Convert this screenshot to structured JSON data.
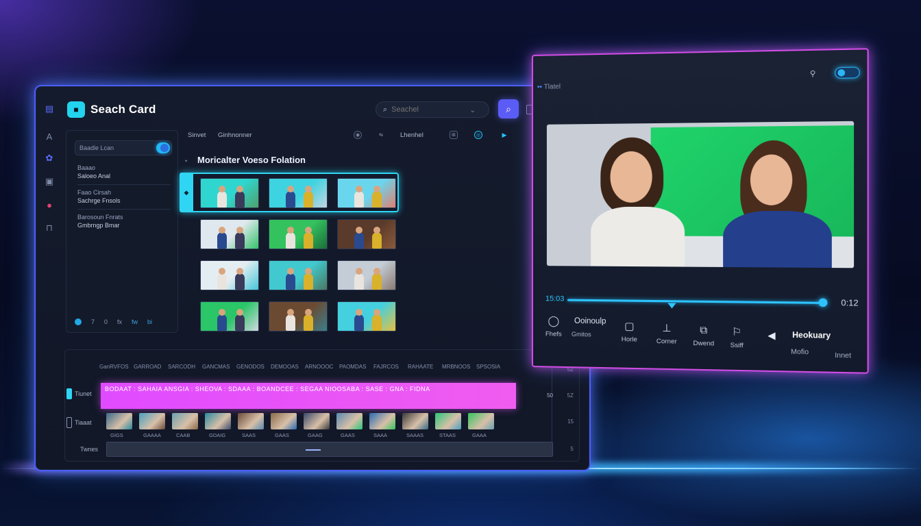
{
  "app": {
    "title": "Seaсh Card",
    "search_placeholder": "Seachel"
  },
  "sidebar_filter": {
    "search_value": "Baadle Lcan",
    "groups": [
      {
        "label": "Baaao",
        "value": "Saloeo Anal"
      },
      {
        "label": "Faao Cirsah",
        "value": "Sachrge Fnsols"
      },
      {
        "label": "Barosoun Fnrats",
        "value": "Gmbrngp Bmar"
      }
    ],
    "footer": [
      "7",
      "0",
      "fx",
      "fw",
      "bi"
    ]
  },
  "results_tabs": [
    "Sinvet",
    "Ginhnonner",
    "Lhenhel"
  ],
  "results_title": "Moricalter Voeso Folation",
  "timeline": {
    "ruler_labels": [
      "GanRVFOS",
      "GARROAD",
      "SARCODH",
      "GANCMAS",
      "GENODOS",
      "DEMOOAS",
      "ARNOOOC",
      "PAOMDAS",
      "FAJRCOS",
      "RAHAATE",
      "MRBNOOS",
      "SPSOSIA"
    ],
    "track1_label": "Tiunet",
    "track2_label": "Tiaaat",
    "track3_label": "Twnes",
    "magenta_text": "BODAAT : SAHAIA ANSGIA : SHEOVA : SDAAA : BOANDCEE : SEGAA NIOOSABA : SASE : GNA : FIDNA",
    "clip_labels": [
      "GIGS",
      "GAAAA",
      "CAAB",
      "GDAIG",
      "SAAS",
      "GAAS",
      "GAAG",
      "GAAS",
      "SAAA",
      "SAAAS",
      "STAAS",
      "GAAA"
    ],
    "right_labels": [
      "5Z",
      "50",
      "5Z",
      "15",
      "5"
    ]
  },
  "player": {
    "header": "Tlatel",
    "time_current": "15:03",
    "time_total": "0:12",
    "progress_fraction": 0.9,
    "controls": [
      {
        "icon": "comment-icon",
        "label": "Fhefs"
      },
      {
        "icon": "square-icon",
        "label": "Horle"
      },
      {
        "icon": "upload-icon",
        "label": "Corner"
      },
      {
        "icon": "copy-icon",
        "label": "Dwend"
      },
      {
        "icon": "flag-icon",
        "label": "Ssiff"
      }
    ],
    "group1_title": "Ooinoulp",
    "group1_sub": "Gmitos",
    "group2_title": "Heokuary",
    "group2_sub1": "Mofio",
    "group2_sub2": "Innet"
  },
  "colors": {
    "accent": "#5b5cf6",
    "cyan": "#2fd6f4",
    "magenta": "#e04bff"
  }
}
